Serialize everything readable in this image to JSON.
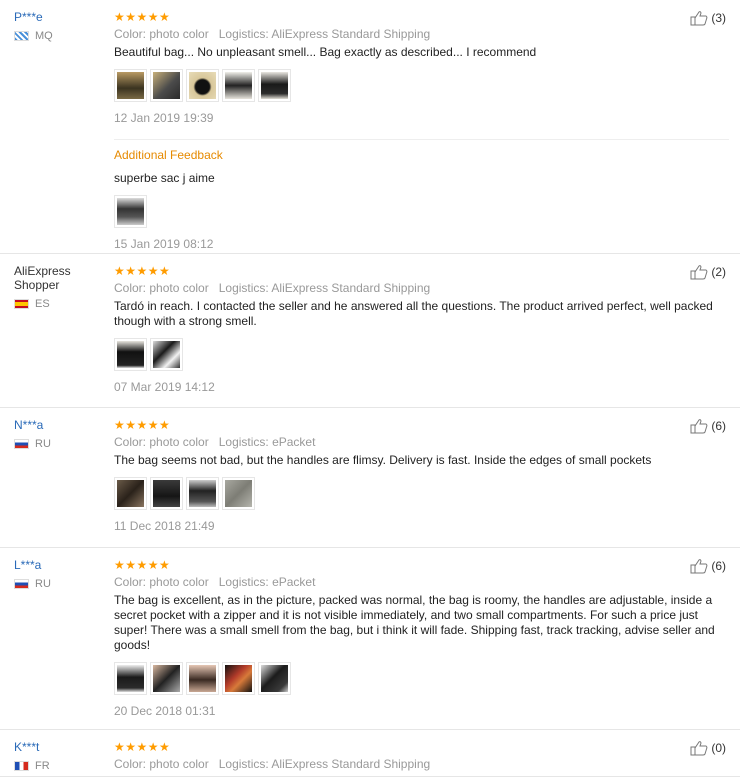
{
  "reviews": [
    {
      "user": "P***e",
      "country": "MQ",
      "stars": "★★★★★",
      "color_label": "Color: photo color",
      "logistics": "Logistics: AliExpress Standard Shipping",
      "text": "Beautiful bag... No unpleasant smell... Bag exactly as described... I recommend",
      "date": "12 Jan 2019 19:39",
      "helpful": "(3)",
      "additional": {
        "title": "Additional Feedback",
        "text": "superbe sac j aime",
        "date": "15 Jan 2019 08:12"
      }
    },
    {
      "user": "AliExpress Shopper",
      "country": "ES",
      "stars": "★★★★★",
      "color_label": "Color: photo color",
      "logistics": "Logistics: AliExpress Standard Shipping",
      "text": "Tardó in reach. I contacted the seller and he answered all the questions. The product arrived perfect, well packed though with a strong smell.",
      "date": "07 Mar 2019 14:12",
      "helpful": "(2)"
    },
    {
      "user": "N***a",
      "country": "RU",
      "stars": "★★★★★",
      "color_label": "Color: photo color",
      "logistics": "Logistics: ePacket",
      "text": "The bag seems not bad, but the handles are flimsy. Delivery is fast. Inside the edges of small pockets",
      "date": "11 Dec 2018 21:49",
      "helpful": "(6)"
    },
    {
      "user": "L***a",
      "country": "RU",
      "stars": "★★★★★",
      "color_label": "Color: photo color",
      "logistics": "Logistics: ePacket",
      "text": "The bag is excellent, as in the picture, packed was normal, the bag is roomy, the handles are adjustable, inside a secret pocket with a zipper and it is not visible immediately, and two small compartments. For such a price just super! There was a small smell from the bag, but i think it will fade. Shipping fast, track tracking, advise seller and goods!",
      "date": "20 Dec 2018 01:31",
      "helpful": "(6)"
    },
    {
      "user": "K***t",
      "country": "FR",
      "stars": "★★★★★",
      "color_label": "Color: photo color",
      "logistics": "Logistics: AliExpress Standard Shipping",
      "helpful": "(0)"
    }
  ]
}
